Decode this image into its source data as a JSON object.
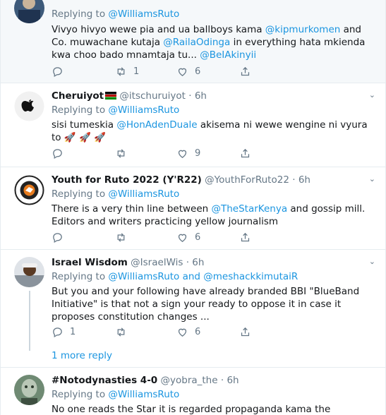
{
  "tweets": [
    {
      "replying_prefix": "Replying to",
      "replying_to": "@WilliamsRuto",
      "text": [
        {
          "t": "Vivyo hivyo wewe pia and ua ballboys kama "
        },
        {
          "m": "@kipmurkomen"
        },
        {
          "t": " and Co. muwachane kutaja "
        },
        {
          "m": "@RailaOdinga"
        },
        {
          "t": " in everything hata mkienda kwa choo bado mnamtaja tu... "
        },
        {
          "m": "@BeIAkinyii"
        }
      ],
      "replies": "",
      "retweets": "1",
      "likes": "6"
    },
    {
      "name": "Cheruiyot",
      "flag": "Kenya flag",
      "handle": "@itschuruiyot",
      "dot": "·",
      "time": "6h",
      "replying_prefix": "Replying to",
      "replying_to": "@WilliamsRuto",
      "text": [
        {
          "t": "sisi tumeskia "
        },
        {
          "m": "@HonAdenDuale"
        },
        {
          "t": "  akisema ni wewe wengine ni vyura to "
        }
      ],
      "emoji": "rocket",
      "replies": "",
      "retweets": "",
      "likes": "9"
    },
    {
      "name": "Youth for Ruto 2022 (Y'R22)",
      "handle": "@YouthForRuto22",
      "dot": "·",
      "time": "6h",
      "replying_prefix": "Replying to",
      "replying_to": "@WilliamsRuto",
      "text": [
        {
          "t": "There is a very thin line between "
        },
        {
          "m": "@TheStarKenya"
        },
        {
          "t": " and gossip mill. Editors and writers practicing yellow journalism"
        }
      ],
      "replies": "",
      "retweets": "",
      "likes": "6"
    },
    {
      "name": "Israel Wisdom",
      "handle": "@IsraelWis",
      "dot": "·",
      "time": "6h",
      "replying_prefix": "Replying to",
      "replying_to": "@WilliamsRuto and @meshackkimutaiR",
      "text": [
        {
          "t": "But you and your following have already branded BBI \"BlueBand Initiative\" is that not a sign your ready to oppose it in case it proposes constitution changes ..."
        }
      ],
      "replies": "1",
      "retweets": "",
      "likes": "6",
      "more_replies": "1 more reply"
    },
    {
      "name": "#Notodynasties 4-0",
      "handle": "@yobra_the",
      "dot": "·",
      "time": "6h",
      "replying_prefix": "Replying to",
      "replying_to": "@WilliamsRuto",
      "text": [
        {
          "t": "No one reads the Star it is regarded propaganda kama the Nairobian"
        }
      ]
    }
  ],
  "colors": {
    "link": "#1b95e0",
    "muted": "#657786",
    "border": "#e6ecf0",
    "highlight_bg": "#f5f8fa"
  },
  "icons": [
    "reply-icon",
    "retweet-icon",
    "like-icon",
    "share-icon",
    "chevron-down-icon"
  ]
}
